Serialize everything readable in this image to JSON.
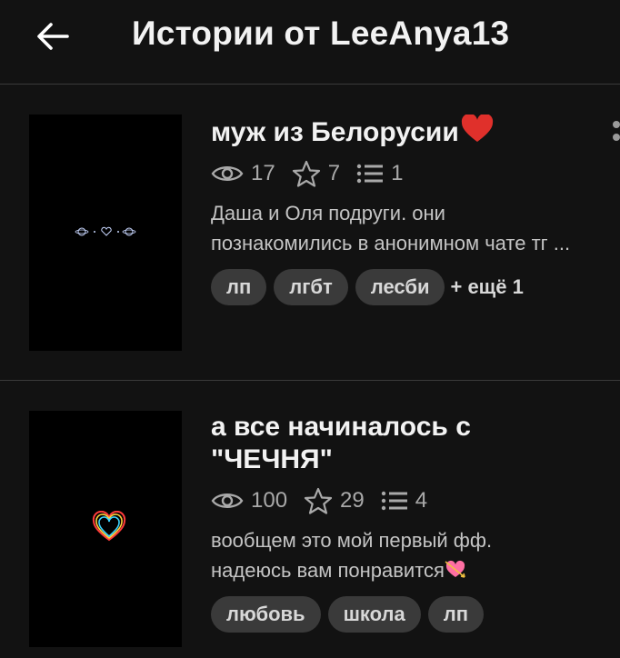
{
  "header": {
    "title": "Истории от LeeAnya13",
    "back_icon": "arrow-left-icon"
  },
  "stories": [
    {
      "title": "муж из Белорусии",
      "title_emoji": "red-heart-icon",
      "views": "17",
      "stars": "7",
      "parts": "1",
      "description_lines": [
        "Даша и Оля подруги. они",
        "познакомились в анонимном чате тг ..."
      ],
      "tags": [
        "лп",
        "лгбт",
        "лесби"
      ],
      "more_tags": "+ ещё 1",
      "cover_icon": "planet-heart-decor-icon"
    },
    {
      "title": "а все начиналось с \"ЧЕЧНЯ\"",
      "title_line1": "а все начиналось с",
      "title_line2": "\"ЧЕЧНЯ\"",
      "views": "100",
      "stars": "29",
      "parts": "4",
      "description_lines": [
        "вообщем это мой первый фф.",
        "надеюсь вам понравится"
      ],
      "description_emoji": "heart-with-arrow-icon",
      "tags": [
        "любовь",
        "школа",
        "лп"
      ],
      "cover_icon": "neon-heart-icon"
    }
  ],
  "colors": {
    "background": "#121212",
    "divider": "#3a3a3a",
    "tag_background": "#3a3a3a",
    "heart_red": "#e0302b"
  }
}
